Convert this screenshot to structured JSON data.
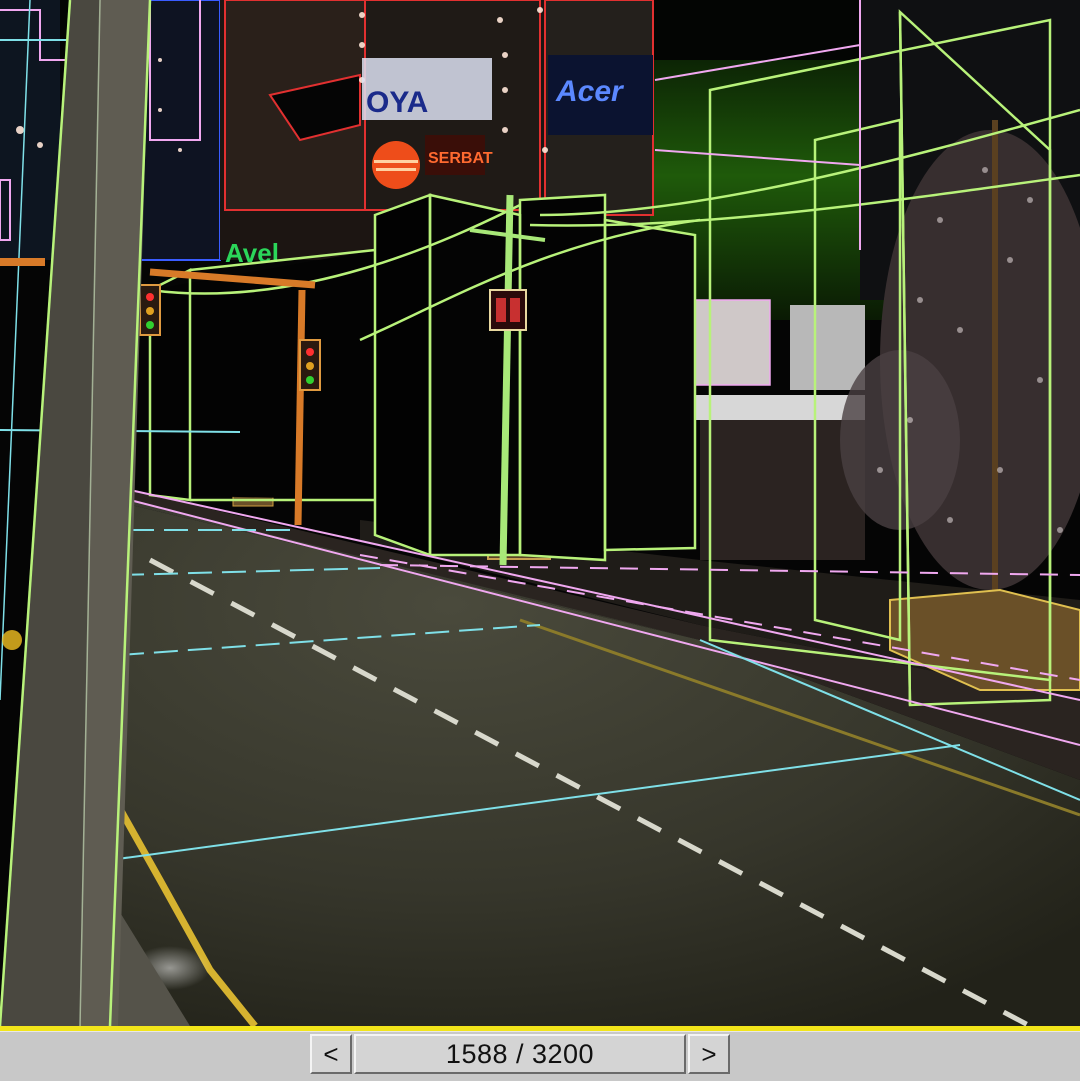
{
  "scene": {
    "billboards": [
      "Acer",
      "OYA",
      "Avel",
      "SERBAT"
    ],
    "colors": {
      "wire_green": "#b8f27a",
      "wire_pink": "#f0a8f0",
      "wire_cyan": "#7fe0e8",
      "wire_yellow": "#f2e51a",
      "road": "#3a3a30",
      "sky_glow": "#3d8c12"
    }
  },
  "timebar": {
    "prev_icon": "chevron-left-icon",
    "next_icon": "chevron-right-icon",
    "prev_label": "<",
    "next_label": ">",
    "frame_display": "1588 / 3200",
    "current_frame": 1588,
    "total_frames": 3200
  }
}
